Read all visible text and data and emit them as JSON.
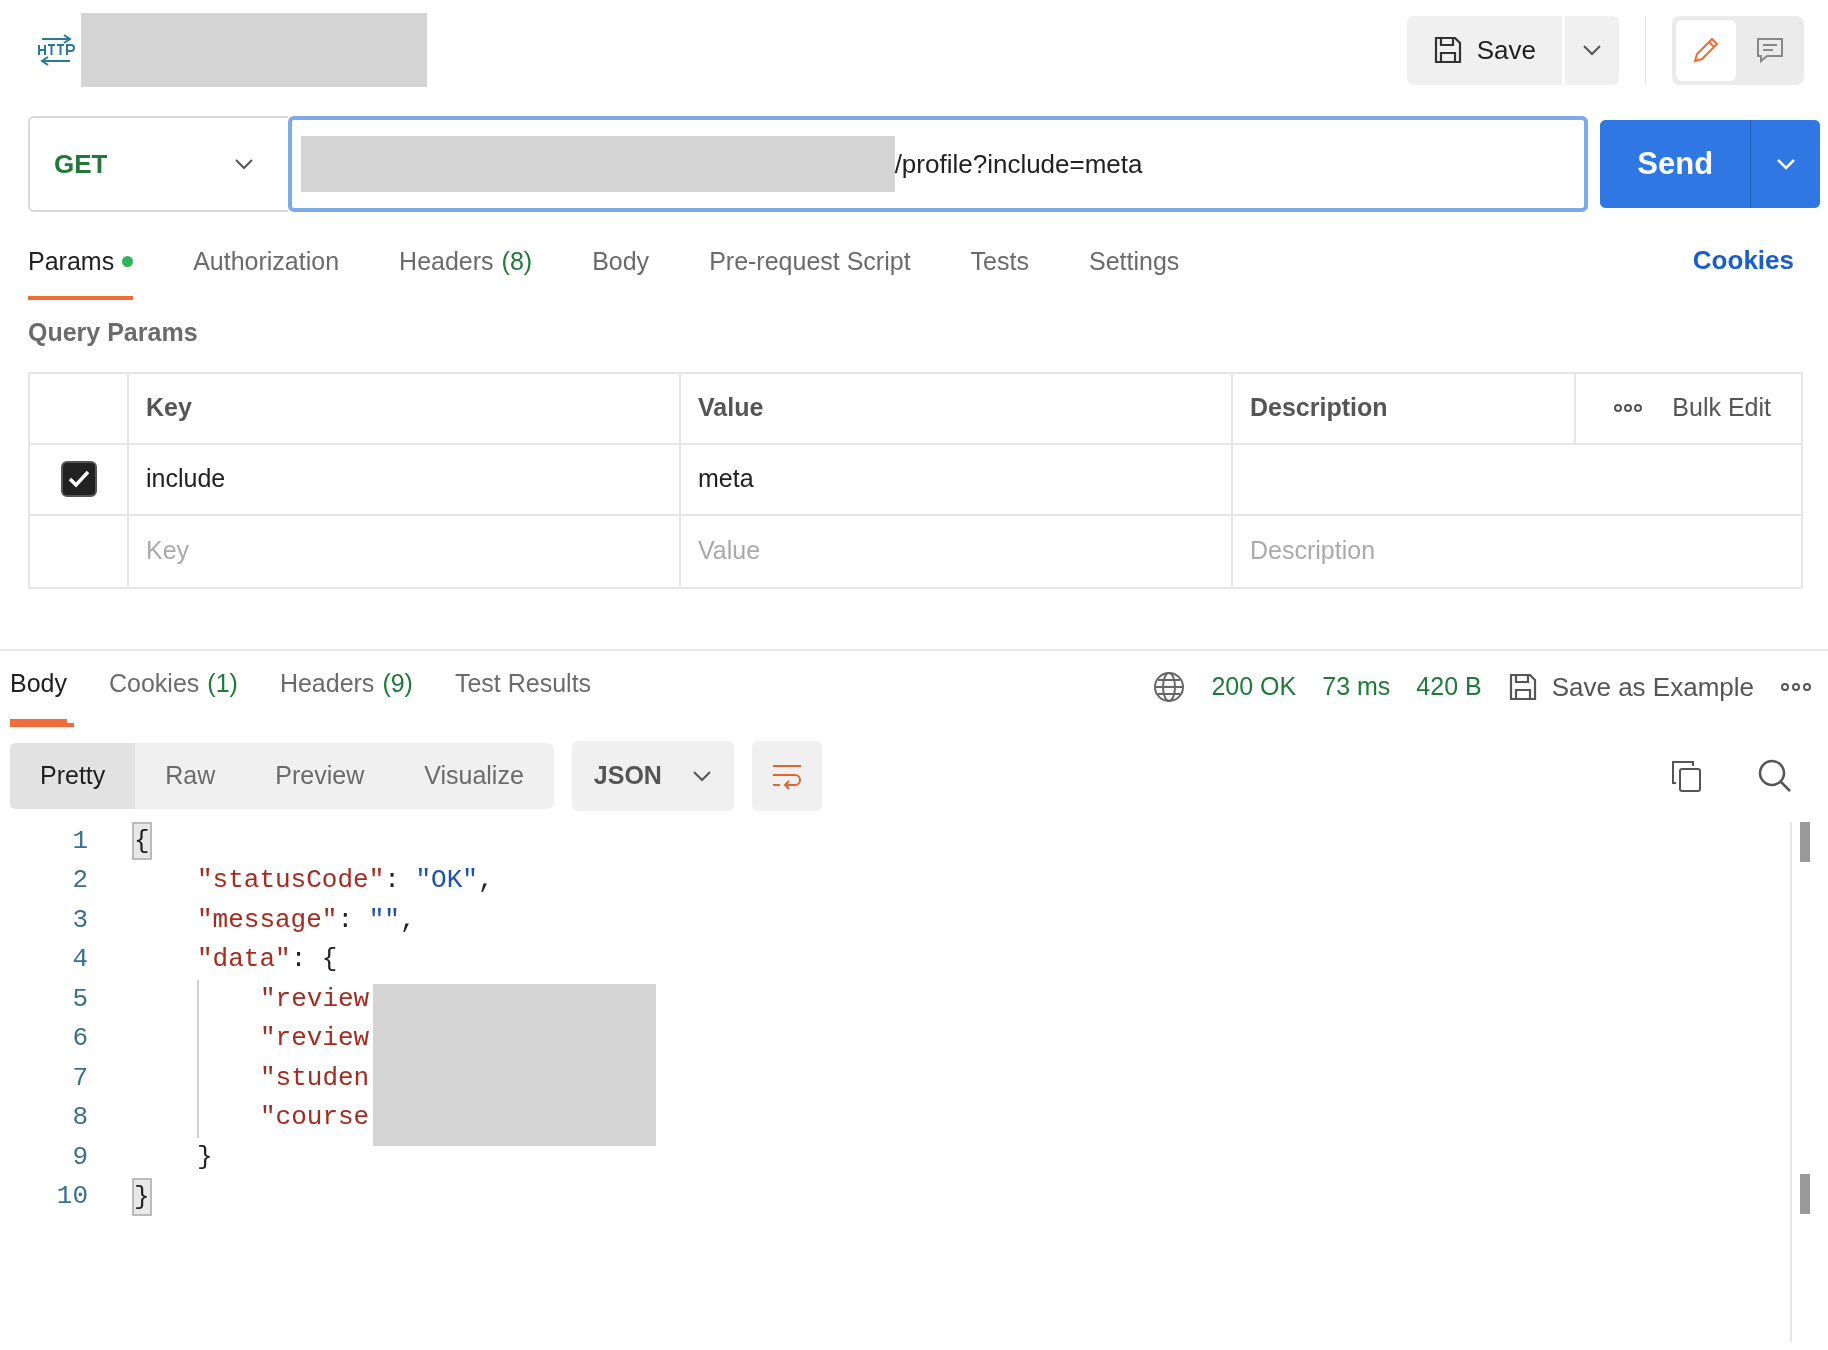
{
  "header": {
    "save_label": "Save",
    "modes": [
      {
        "kind": "edit",
        "selected": true
      },
      {
        "kind": "comment",
        "selected": false
      }
    ]
  },
  "request": {
    "method": "GET",
    "url": "/profile?include=meta",
    "send_label": "Send"
  },
  "request_tabs": [
    {
      "label": "Params",
      "dot": true,
      "selected": true
    },
    {
      "label": "Authorization",
      "selected": false
    },
    {
      "label": "Headers",
      "count": "(8)",
      "selected": false
    },
    {
      "label": "Body",
      "selected": false
    },
    {
      "label": "Pre-request Script",
      "selected": false
    },
    {
      "label": "Tests",
      "selected": false
    },
    {
      "label": "Settings",
      "selected": false
    }
  ],
  "cookies_link": "Cookies",
  "query_params": {
    "title": "Query Params",
    "columns": [
      "Key",
      "Value",
      "Description"
    ],
    "bulk_edit": "Bulk Edit",
    "rows": [
      {
        "checked": true,
        "key": "include",
        "value": "meta"
      }
    ],
    "placeholders": {
      "key": "Key",
      "value": "Value",
      "description": "Description"
    }
  },
  "response_tabs": [
    {
      "label": "Body",
      "selected": true
    },
    {
      "label": "Cookies",
      "count": "(1)",
      "selected": false
    },
    {
      "label": "Headers",
      "count": "(9)",
      "selected": false
    },
    {
      "label": "Test Results",
      "selected": false
    }
  ],
  "response_status": {
    "status": "200 OK",
    "time": "73 ms",
    "size": "420 B",
    "save_example": "Save as Example"
  },
  "view_modes": [
    {
      "label": "Pretty",
      "selected": true
    },
    {
      "label": "Raw",
      "selected": false
    },
    {
      "label": "Preview",
      "selected": false
    },
    {
      "label": "Visualize",
      "selected": false
    }
  ],
  "format": "JSON",
  "wrap_on": true,
  "code_lines": [
    {
      "number": "1",
      "tokens": [
        {
          "kind": "bracket",
          "text": "{",
          "matched": true
        }
      ],
      "children": [
        {
          "number": "2",
          "tokens": [
            {
              "kind": "key",
              "text": "\"statusCode\""
            },
            {
              "kind": "punct",
              "text": ": "
            },
            {
              "kind": "string",
              "text": "\"OK\""
            },
            {
              "kind": "punct",
              "text": ","
            }
          ]
        },
        {
          "number": "3",
          "tokens": [
            {
              "kind": "key",
              "text": "\"message\""
            },
            {
              "kind": "punct",
              "text": ": "
            },
            {
              "kind": "string",
              "text": "\"\""
            },
            {
              "kind": "punct",
              "text": ","
            }
          ]
        },
        {
          "number": "4",
          "tokens": [
            {
              "kind": "key",
              "text": "\"data\""
            },
            {
              "kind": "punct",
              "text": ": "
            },
            {
              "kind": "bracket",
              "text": "{",
              "matched": false
            }
          ],
          "children": [
            {
              "number": "5",
              "tokens": [
                {
                  "kind": "key",
                  "text": "\"review"
                }
              ]
            },
            {
              "number": "6",
              "tokens": [
                {
                  "kind": "key",
                  "text": "\"review"
                }
              ]
            },
            {
              "number": "7",
              "tokens": [
                {
                  "kind": "key",
                  "text": "\"studen"
                }
              ]
            },
            {
              "number": "8",
              "tokens": [
                {
                  "kind": "key",
                  "text": "\"course"
                }
              ]
            }
          ]
        },
        {
          "number": "9",
          "tokens": [
            {
              "kind": "bracket",
              "text": "}",
              "matched": false
            }
          ]
        }
      ]
    },
    {
      "number": "10",
      "tokens": [
        {
          "kind": "bracket",
          "text": "}",
          "matched": true
        }
      ]
    }
  ]
}
